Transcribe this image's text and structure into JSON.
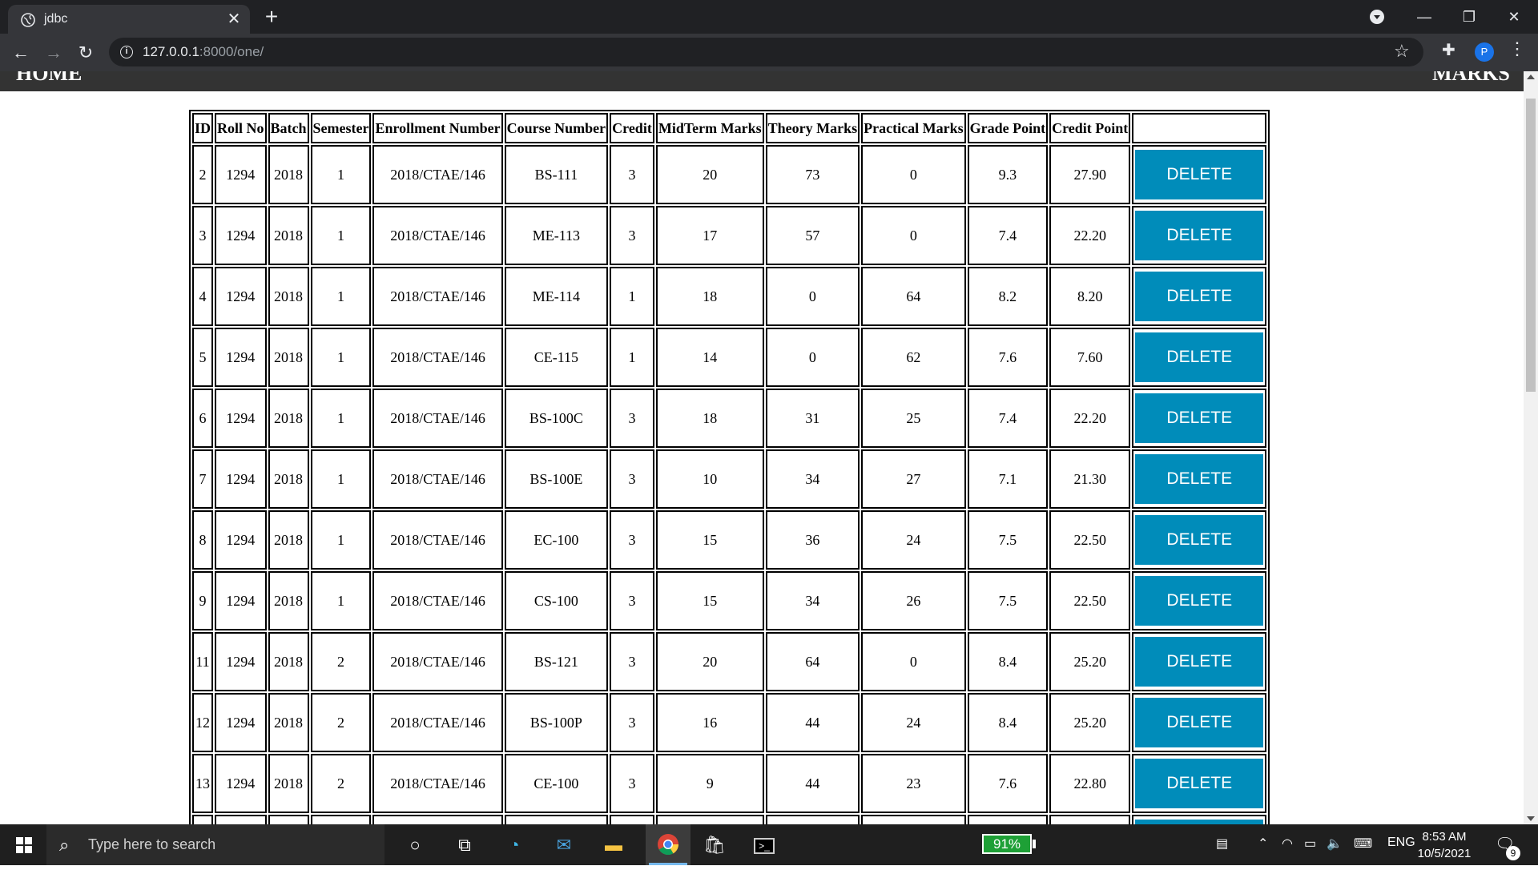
{
  "browser": {
    "tab_title": "jdbc",
    "tab_close": "✕",
    "new_tab": "+",
    "url_host": "127.0.0.1",
    "url_path": ":8000/one/"
  },
  "page": {
    "nav_left": "HOME",
    "nav_right": "MARKS",
    "delete_label": "DELETE",
    "columns": [
      "ID",
      "Roll No",
      "Batch",
      "Semester",
      "Enrollment Number",
      "Course Number",
      "Credit",
      "MidTerm Marks",
      "Theory Marks",
      "Practical Marks",
      "Grade Point",
      "Credit Point"
    ],
    "rows": [
      [
        "2",
        "1294",
        "2018",
        "1",
        "2018/CTAE/146",
        "BS-111",
        "3",
        "20",
        "73",
        "0",
        "9.3",
        "27.90"
      ],
      [
        "3",
        "1294",
        "2018",
        "1",
        "2018/CTAE/146",
        "ME-113",
        "3",
        "17",
        "57",
        "0",
        "7.4",
        "22.20"
      ],
      [
        "4",
        "1294",
        "2018",
        "1",
        "2018/CTAE/146",
        "ME-114",
        "1",
        "18",
        "0",
        "64",
        "8.2",
        "8.20"
      ],
      [
        "5",
        "1294",
        "2018",
        "1",
        "2018/CTAE/146",
        "CE-115",
        "1",
        "14",
        "0",
        "62",
        "7.6",
        "7.60"
      ],
      [
        "6",
        "1294",
        "2018",
        "1",
        "2018/CTAE/146",
        "BS-100C",
        "3",
        "18",
        "31",
        "25",
        "7.4",
        "22.20"
      ],
      [
        "7",
        "1294",
        "2018",
        "1",
        "2018/CTAE/146",
        "BS-100E",
        "3",
        "10",
        "34",
        "27",
        "7.1",
        "21.30"
      ],
      [
        "8",
        "1294",
        "2018",
        "1",
        "2018/CTAE/146",
        "EC-100",
        "3",
        "15",
        "36",
        "24",
        "7.5",
        "22.50"
      ],
      [
        "9",
        "1294",
        "2018",
        "1",
        "2018/CTAE/146",
        "CS-100",
        "3",
        "15",
        "34",
        "26",
        "7.5",
        "22.50"
      ],
      [
        "11",
        "1294",
        "2018",
        "2",
        "2018/CTAE/146",
        "BS-121",
        "3",
        "20",
        "64",
        "0",
        "8.4",
        "25.20"
      ],
      [
        "12",
        "1294",
        "2018",
        "2",
        "2018/CTAE/146",
        "BS-100P",
        "3",
        "16",
        "44",
        "24",
        "8.4",
        "25.20"
      ],
      [
        "13",
        "1294",
        "2018",
        "2",
        "2018/CTAE/146",
        "CE-100",
        "3",
        "9",
        "44",
        "23",
        "7.6",
        "22.80"
      ],
      [
        "",
        "",
        "",
        "",
        "",
        "",
        "",
        "",
        "",
        "",
        "",
        ""
      ]
    ]
  },
  "taskbar": {
    "search_placeholder": "Type here to search",
    "battery": "91%",
    "language": "ENG",
    "time": "8:53 AM",
    "date": "10/5/2021",
    "notification_count": "9"
  },
  "colors": {
    "delete_button": "#008cba",
    "nav_bar": "#333333",
    "battery_fill": "#1ea036"
  }
}
